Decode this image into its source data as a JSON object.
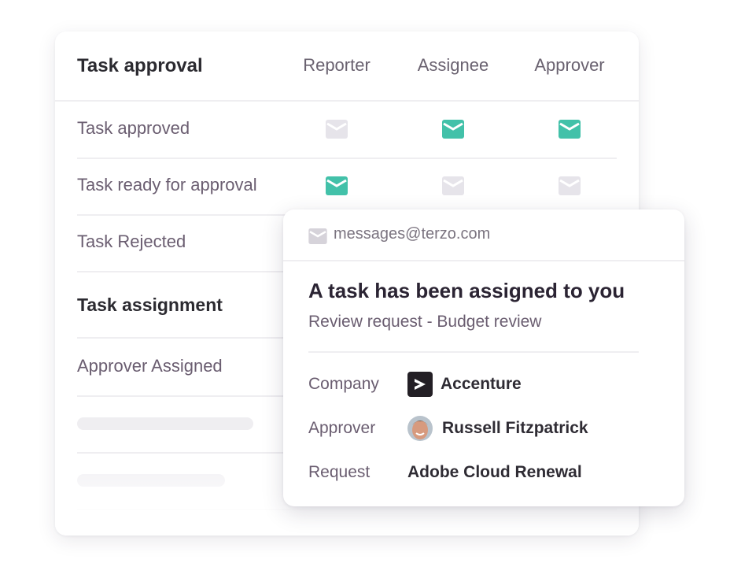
{
  "colors": {
    "active": "#42c1a9",
    "inactive": "#e6e4ea"
  },
  "table": {
    "title": "Task approval",
    "columns": [
      "Reporter",
      "Assignee",
      "Approver"
    ],
    "rows": [
      {
        "label": "Task approved",
        "type": "item",
        "states": [
          "inactive",
          "active",
          "active"
        ]
      },
      {
        "label": "Task ready for approval",
        "type": "item",
        "states": [
          "active",
          "inactive",
          "inactive"
        ]
      },
      {
        "label": "Task Rejected",
        "type": "item"
      },
      {
        "label": "Task assignment",
        "type": "section"
      },
      {
        "label": "Approver Assigned",
        "type": "item"
      }
    ]
  },
  "email": {
    "from": "messages@terzo.com",
    "subject": "A task has been assigned to you",
    "subline": "Review request - Budget review",
    "details": [
      {
        "label": "Company",
        "value": "Accenture",
        "icon": "accenture-logo"
      },
      {
        "label": "Approver",
        "value": "Russell Fitzpatrick",
        "icon": "avatar"
      },
      {
        "label": "Request",
        "value": "Adobe Cloud Renewal"
      }
    ]
  }
}
